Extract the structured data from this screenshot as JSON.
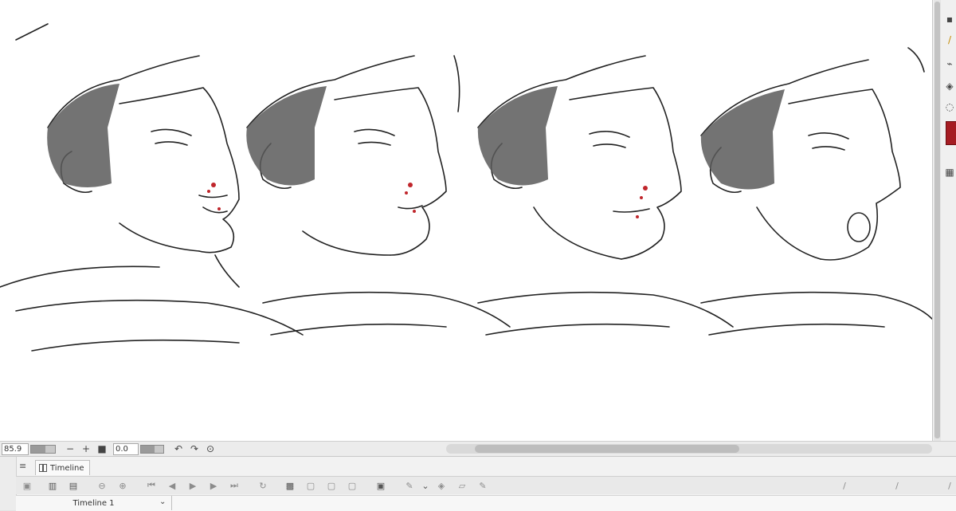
{
  "canvas": {
    "description_free": true,
    "ink_color": "#222222",
    "tone_color": "#5a5a5a",
    "blood_color": "#c0262c"
  },
  "zoom": {
    "value": "85.9",
    "rotation": "0.0",
    "zoom_out_label": "−",
    "zoom_in_label": "+"
  },
  "timeline": {
    "tab_label": "Timeline",
    "selector_value": "Timeline 1",
    "menu_glyph": "≡"
  },
  "colors": {
    "main_color": "#a51c22"
  }
}
